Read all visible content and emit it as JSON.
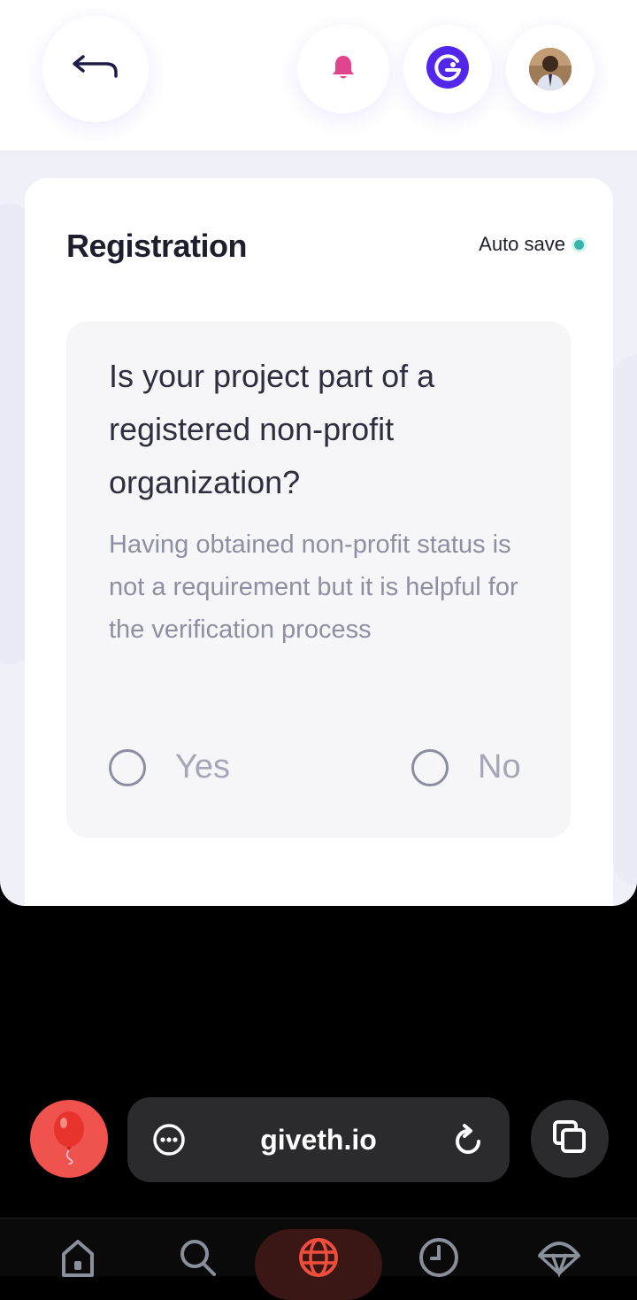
{
  "header": {
    "back_icon": "back-arrow-icon",
    "notification_icon": "bell-icon",
    "wallet_icon": "wallet-logo-icon",
    "profile_icon": "avatar"
  },
  "card": {
    "title": "Registration",
    "autosave_label": "Auto save",
    "question": "Is your project part of a registered non-profit organization?",
    "hint": "Having obtained non-profit status is not a requirement but it is helpful for the verification process",
    "options": [
      {
        "label": "Yes",
        "selected": false
      },
      {
        "label": "No",
        "selected": false
      }
    ]
  },
  "colors": {
    "accent": "#5326ec",
    "bell": "#e1458d",
    "autosave_dot": "#37b4a9",
    "balloon_bg": "#f0524e"
  },
  "browser": {
    "url": "giveth.io",
    "menu_icon": "more-icon",
    "reload_icon": "reload-icon",
    "tabs_icon": "tabs-icon",
    "balloon_icon": "balloon-icon"
  },
  "nav": {
    "items": [
      "home-icon",
      "search-icon",
      "globe-icon",
      "history-icon",
      "parachute-icon"
    ],
    "active": "globe-icon"
  }
}
